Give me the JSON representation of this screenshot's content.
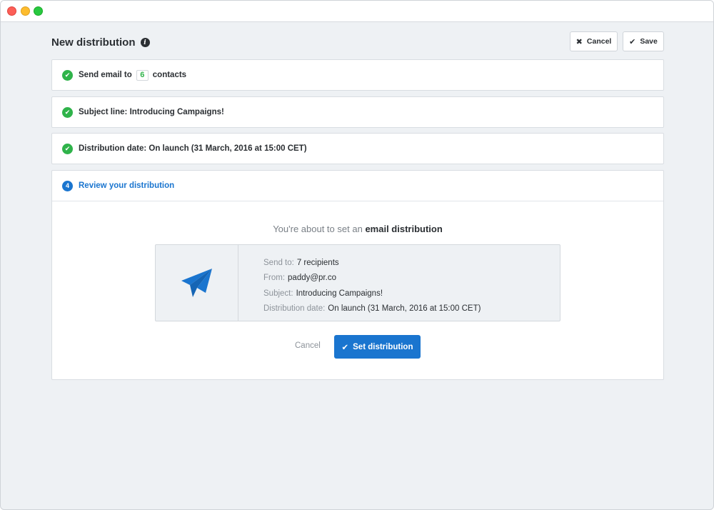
{
  "header": {
    "title": "New distribution",
    "cancel_label": "Cancel",
    "save_label": "Save"
  },
  "steps": [
    {
      "status": "complete",
      "prefix": "Send email to",
      "count": "6",
      "suffix": "contacts"
    },
    {
      "status": "complete",
      "label": "Subject line: Introducing Campaigns!"
    },
    {
      "status": "complete",
      "label": "Distribution date: On launch (31 March, 2016 at 15:00 CET)"
    },
    {
      "status": "active",
      "number": "4",
      "label": "Review your distribution"
    }
  ],
  "review": {
    "summary_prefix": "You're about to set an",
    "summary_highlight": "email distribution",
    "details": [
      {
        "label": "Send to:",
        "value": "7 recipients"
      },
      {
        "label": "From:",
        "value": "paddy@pr.co"
      },
      {
        "label": "Subject:",
        "value": "Introducing Campaigns!"
      },
      {
        "label": "Distribution date:",
        "value": "On launch (31 March, 2016 at 15:00 CET)"
      }
    ],
    "cancel_label": "Cancel",
    "submit_label": "Set distribution"
  },
  "icons": {
    "header_cancel": "close-icon",
    "header_save": "check-icon",
    "completed_step": "check-circle-icon",
    "card": "paper-plane-icon"
  },
  "colors": {
    "accent": "#1a75cf",
    "success": "#2fb34a",
    "background": "#eef1f4"
  }
}
